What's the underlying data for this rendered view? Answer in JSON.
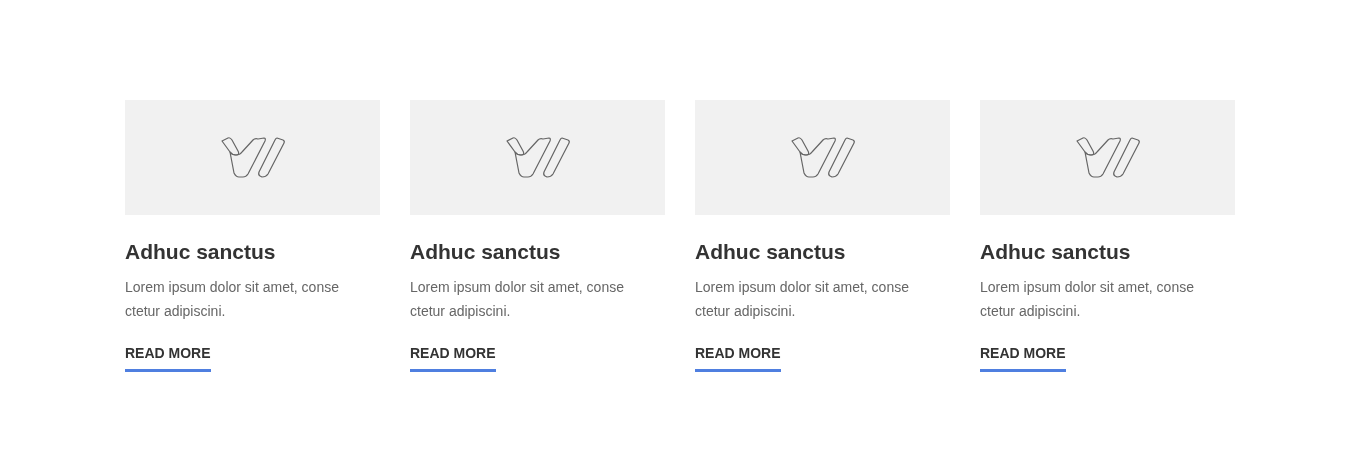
{
  "cards": [
    {
      "title": "Adhuc sanctus",
      "text": "Lorem ipsum dolor sit amet, conse ctetur adipiscini.",
      "link": "READ MORE"
    },
    {
      "title": "Adhuc sanctus",
      "text": "Lorem ipsum dolor sit amet, conse ctetur adipiscini.",
      "link": "READ MORE"
    },
    {
      "title": "Adhuc sanctus",
      "text": "Lorem ipsum dolor sit amet, conse ctetur adipiscini.",
      "link": "READ MORE"
    },
    {
      "title": "Adhuc sanctus",
      "text": "Lorem ipsum dolor sit amet, conse ctetur adipiscini.",
      "link": "READ MORE"
    }
  ]
}
